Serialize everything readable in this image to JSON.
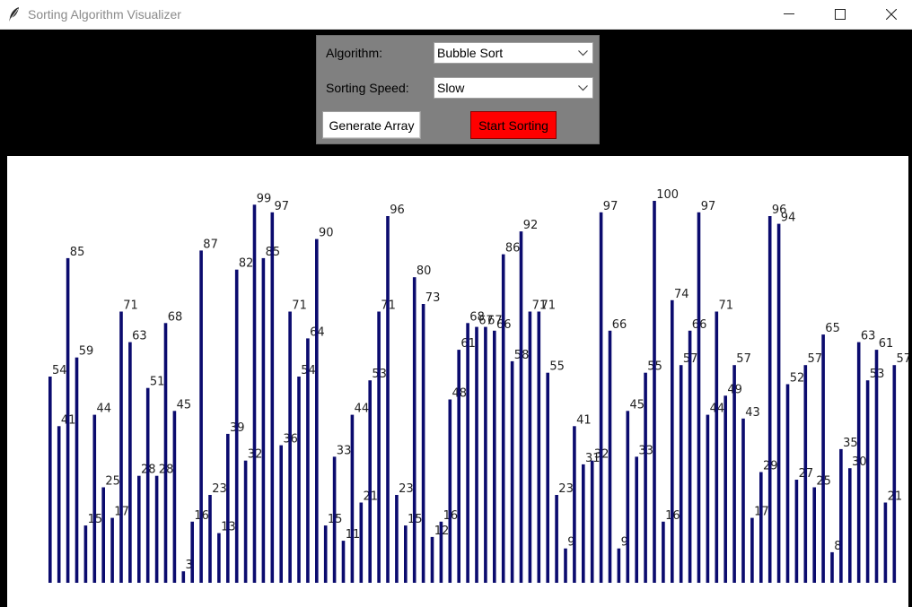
{
  "window": {
    "title": "Sorting Algorithm Visualizer",
    "icon": "feather-icon"
  },
  "controls": {
    "algorithm_label": "Algorithm:",
    "algorithm_value": "Bubble Sort",
    "speed_label": "Sorting Speed:",
    "speed_value": "Slow",
    "generate_label": "Generate Array",
    "start_label": "Start Sorting"
  },
  "colors": {
    "bar": "#0b0b6e",
    "start_button": "#ff0000",
    "panel": "#808080",
    "background": "#000000",
    "canvas": "#ffffff"
  },
  "chart_data": {
    "type": "bar",
    "values": [
      54,
      41,
      85,
      59,
      15,
      44,
      25,
      17,
      71,
      63,
      28,
      51,
      28,
      68,
      45,
      3,
      16,
      87,
      23,
      13,
      39,
      82,
      32,
      99,
      85,
      97,
      36,
      71,
      54,
      64,
      90,
      15,
      33,
      11,
      44,
      21,
      53,
      71,
      96,
      23,
      15,
      80,
      73,
      12,
      16,
      48,
      61,
      68,
      67,
      67,
      66,
      86,
      58,
      92,
      71,
      71,
      55,
      23,
      9,
      41,
      31,
      32,
      97,
      66,
      9,
      45,
      33,
      55,
      100,
      16,
      74,
      57,
      66,
      97,
      44,
      71,
      49,
      57,
      43,
      17,
      29,
      96,
      94,
      52,
      27,
      57,
      25,
      65,
      8,
      35,
      30,
      63,
      53,
      61,
      21,
      57
    ],
    "ylim": [
      0,
      100
    ]
  }
}
